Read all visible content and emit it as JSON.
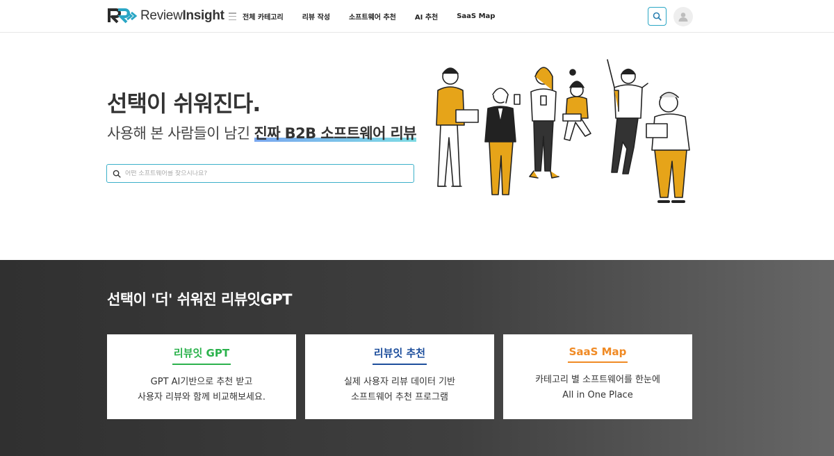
{
  "header": {
    "logo_text_regular": "Review",
    "logo_text_bold": "Insight",
    "nav": [
      "전체 카테고리",
      "리뷰 작성",
      "소프트웨어 추천",
      "AI 추천",
      "SaaS Map"
    ]
  },
  "hero": {
    "title": "선택이 쉬워진다.",
    "subtitle_plain": "사용해 본 사람들이 남긴 ",
    "subtitle_highlight": "진짜 B2B 소프트웨어 리뷰",
    "search_placeholder": "어떤 소프트웨어를 찾으시나요?"
  },
  "gpt_section": {
    "title": "선택이 '더' 쉬워진 리뷰잇GPT",
    "cards": [
      {
        "title": "리뷰잇 GPT",
        "line1": "GPT AI기반으로 추천 받고",
        "line2": "사용자 리뷰와 함께 비교해보세요.",
        "color": "#2bb24c"
      },
      {
        "title": "리뷰잇 추천",
        "line1": "실제 사용자 리뷰 데이터 기반",
        "line2": "소프트웨어 추천 프로그램",
        "color": "#1d4e9c"
      },
      {
        "title": "SaaS Map",
        "line1": "카테고리 별 소프트웨어를 한눈에",
        "line2": "All in One Place",
        "color": "#f08a24"
      }
    ]
  },
  "icons": [
    "logo-icon",
    "menu-icon",
    "search-icon",
    "user-icon"
  ],
  "colors": {
    "accent": "#2aa6c5",
    "dark_bg": "#3a3a3a",
    "illustration_yellow": "#e6a419"
  }
}
